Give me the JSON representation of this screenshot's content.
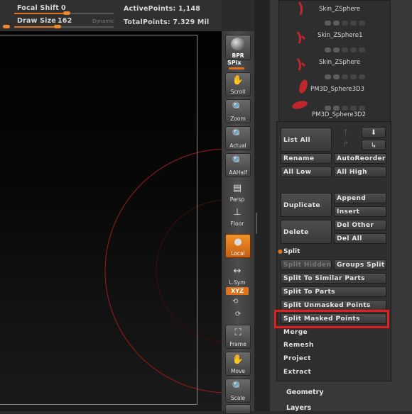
{
  "topbar": {
    "focal_shift_label": "Focal Shift",
    "focal_shift_value": "0",
    "draw_size_label": "Draw Size",
    "draw_size_value": "162",
    "dynamic_label": "Dynamic",
    "active_points": "ActivePoints: 1,148",
    "total_points": "TotalPoints: 7.329 Mil"
  },
  "shelf": {
    "bpr": "BPR",
    "spix": "SPix",
    "scroll": "Scroll",
    "zoom": "Zoom",
    "actual": "Actual",
    "aahalf": "AAHalf",
    "persp": "Persp",
    "floor": "Floor",
    "local": "Local",
    "lsym": "L.Sym",
    "xyz": "XYZ",
    "frame": "Frame",
    "move": "Move",
    "scale": "Scale"
  },
  "subtools": [
    {
      "name": "Skin_ZSphere",
      "thumb_color": "#c0272d"
    },
    {
      "name": "Skin_ZSphere1",
      "thumb_color": "#c0272d"
    },
    {
      "name": "Skin_ZSphere",
      "thumb_color": "#c0272d"
    },
    {
      "name": "PM3D_Sphere3D3",
      "thumb_color": "#c0272d"
    },
    {
      "name": "PM3D_Sphere3D2",
      "thumb_color": "#c0272d"
    }
  ],
  "buttons": {
    "list_all": "List All",
    "rename": "Rename",
    "auto_reorder": "AutoReorder",
    "all_low": "All Low",
    "all_high": "All High",
    "duplicate": "Duplicate",
    "append": "Append",
    "insert": "Insert",
    "delete": "Delete",
    "del_other": "Del Other",
    "del_all": "Del All"
  },
  "split": {
    "title": "Split",
    "split_hidden": "Split Hidden",
    "groups_split": "Groups Split",
    "split_similar": "Split To Similar Parts",
    "split_parts": "Split To Parts",
    "split_unmasked": "Split Unmasked Points",
    "split_masked": "Split Masked Points"
  },
  "subpalettes": {
    "merge": "Merge",
    "remesh": "Remesh",
    "project": "Project",
    "extract": "Extract"
  },
  "menus": {
    "geometry": "Geometry",
    "layers": "Layers"
  },
  "colors": {
    "accent": "#e2731e",
    "highlight": "#e0201e"
  }
}
